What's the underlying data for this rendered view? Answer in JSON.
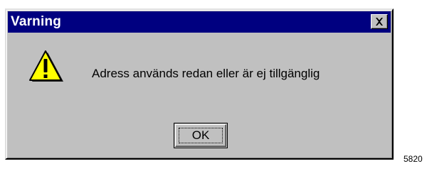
{
  "dialog": {
    "title": "Varning",
    "message": "Adress används redan eller är ej tillgänglig",
    "ok_label": "OK",
    "close_icon": "close-x",
    "message_icon": "warning-triangle-exclamation",
    "colors": {
      "titlebar": "#000080",
      "face": "#c0c0c0",
      "warning_fill": "#ffff00"
    }
  },
  "figure_number": "5820"
}
